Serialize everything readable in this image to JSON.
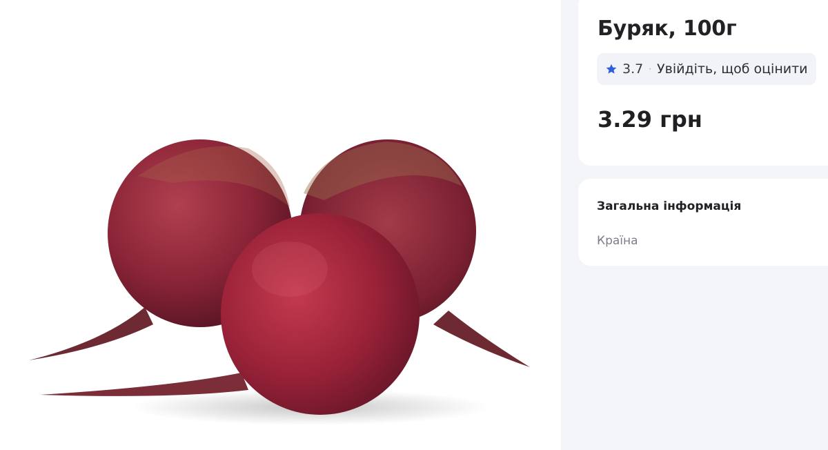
{
  "product": {
    "title": "Буряк, 100г",
    "price": "3.29 грн"
  },
  "rating": {
    "value": "3.7",
    "separator": "·",
    "login_prompt": "Увійдіть, щоб оцінити",
    "star_icon": "star-icon",
    "star_color": "#2f5fd6"
  },
  "general_info": {
    "title": "Загальна інформація",
    "country_label": "Країна"
  },
  "image": {
    "subject": "beetroot"
  }
}
